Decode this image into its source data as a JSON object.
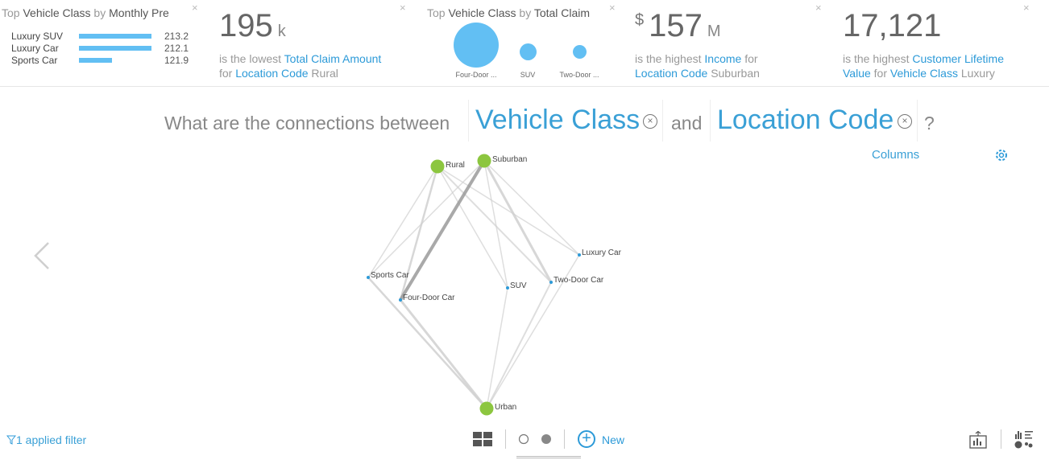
{
  "cards": {
    "premium": {
      "title_pre": "Top ",
      "title_field": "Vehicle Class",
      "title_mid": " by ",
      "title_measure": "Monthly Pre",
      "close": "×",
      "rows": [
        {
          "label": "Luxury SUV",
          "value": "213.2",
          "fraction": 1.0
        },
        {
          "label": "Luxury Car",
          "value": "212.1",
          "fraction": 0.995
        },
        {
          "label": "Sports Car",
          "value": "121.9",
          "fraction": 0.45
        }
      ]
    },
    "claim_min": {
      "value": "195",
      "unit": "k",
      "close": "×",
      "desc_pre": "is the lowest ",
      "measure": "Total Claim Amount",
      "desc_for": "for ",
      "dimension": "Location Code",
      "member": "Rural"
    },
    "claim_bubbles": {
      "title_pre": "Top ",
      "title_field": "Vehicle Class",
      "title_mid": " by ",
      "title_measure": "Total Claim",
      "close": "×",
      "bubbles": [
        {
          "label": "Four-Door ...",
          "size": 1.0
        },
        {
          "label": "SUV",
          "size": 0.38
        },
        {
          "label": "Two-Door ...",
          "size": 0.3
        }
      ]
    },
    "income_max": {
      "currency": "$",
      "value": "157",
      "unit": "M",
      "close": "×",
      "desc_pre": "is the highest ",
      "measure": "Income",
      "desc_for": " for",
      "dimension": "Location Code",
      "member": "Suburban"
    },
    "clv_max": {
      "value": "17,121",
      "close": "×",
      "desc_pre": "is the highest ",
      "measure_a": "Customer Lifetime",
      "measure_b": "Value",
      "desc_for": " for ",
      "dimension": "Vehicle Class",
      "member": "Luxury"
    }
  },
  "question": {
    "prefix": "What are the connections between",
    "field_a": "Vehicle Class",
    "connector": "and",
    "field_b": "Location Code",
    "suffix": "?",
    "remove_glyph": "×"
  },
  "columns_label": "Columns",
  "graph": {
    "top_nodes": [
      "Rural",
      "Suburban"
    ],
    "bottom_nodes": [
      "Urban"
    ],
    "middle_nodes": [
      "Sports Car",
      "Four-Door Car",
      "SUV",
      "Two-Door Car",
      "Luxury Car"
    ],
    "colors": {
      "location_node": "#8cc63f",
      "class_node": "#2c9ad8",
      "edge": "#d0d0d0",
      "edge_strong": "#9a9a9a"
    }
  },
  "footer": {
    "filter_label": "1 applied filter",
    "new_label": "New"
  },
  "icons": {
    "filter": "funnel-icon",
    "grid": "grid-layout-icon",
    "gear": "gear-icon",
    "prev": "chevron-left-icon",
    "export": "export-report-icon",
    "chart_types": "chart-types-icon"
  }
}
